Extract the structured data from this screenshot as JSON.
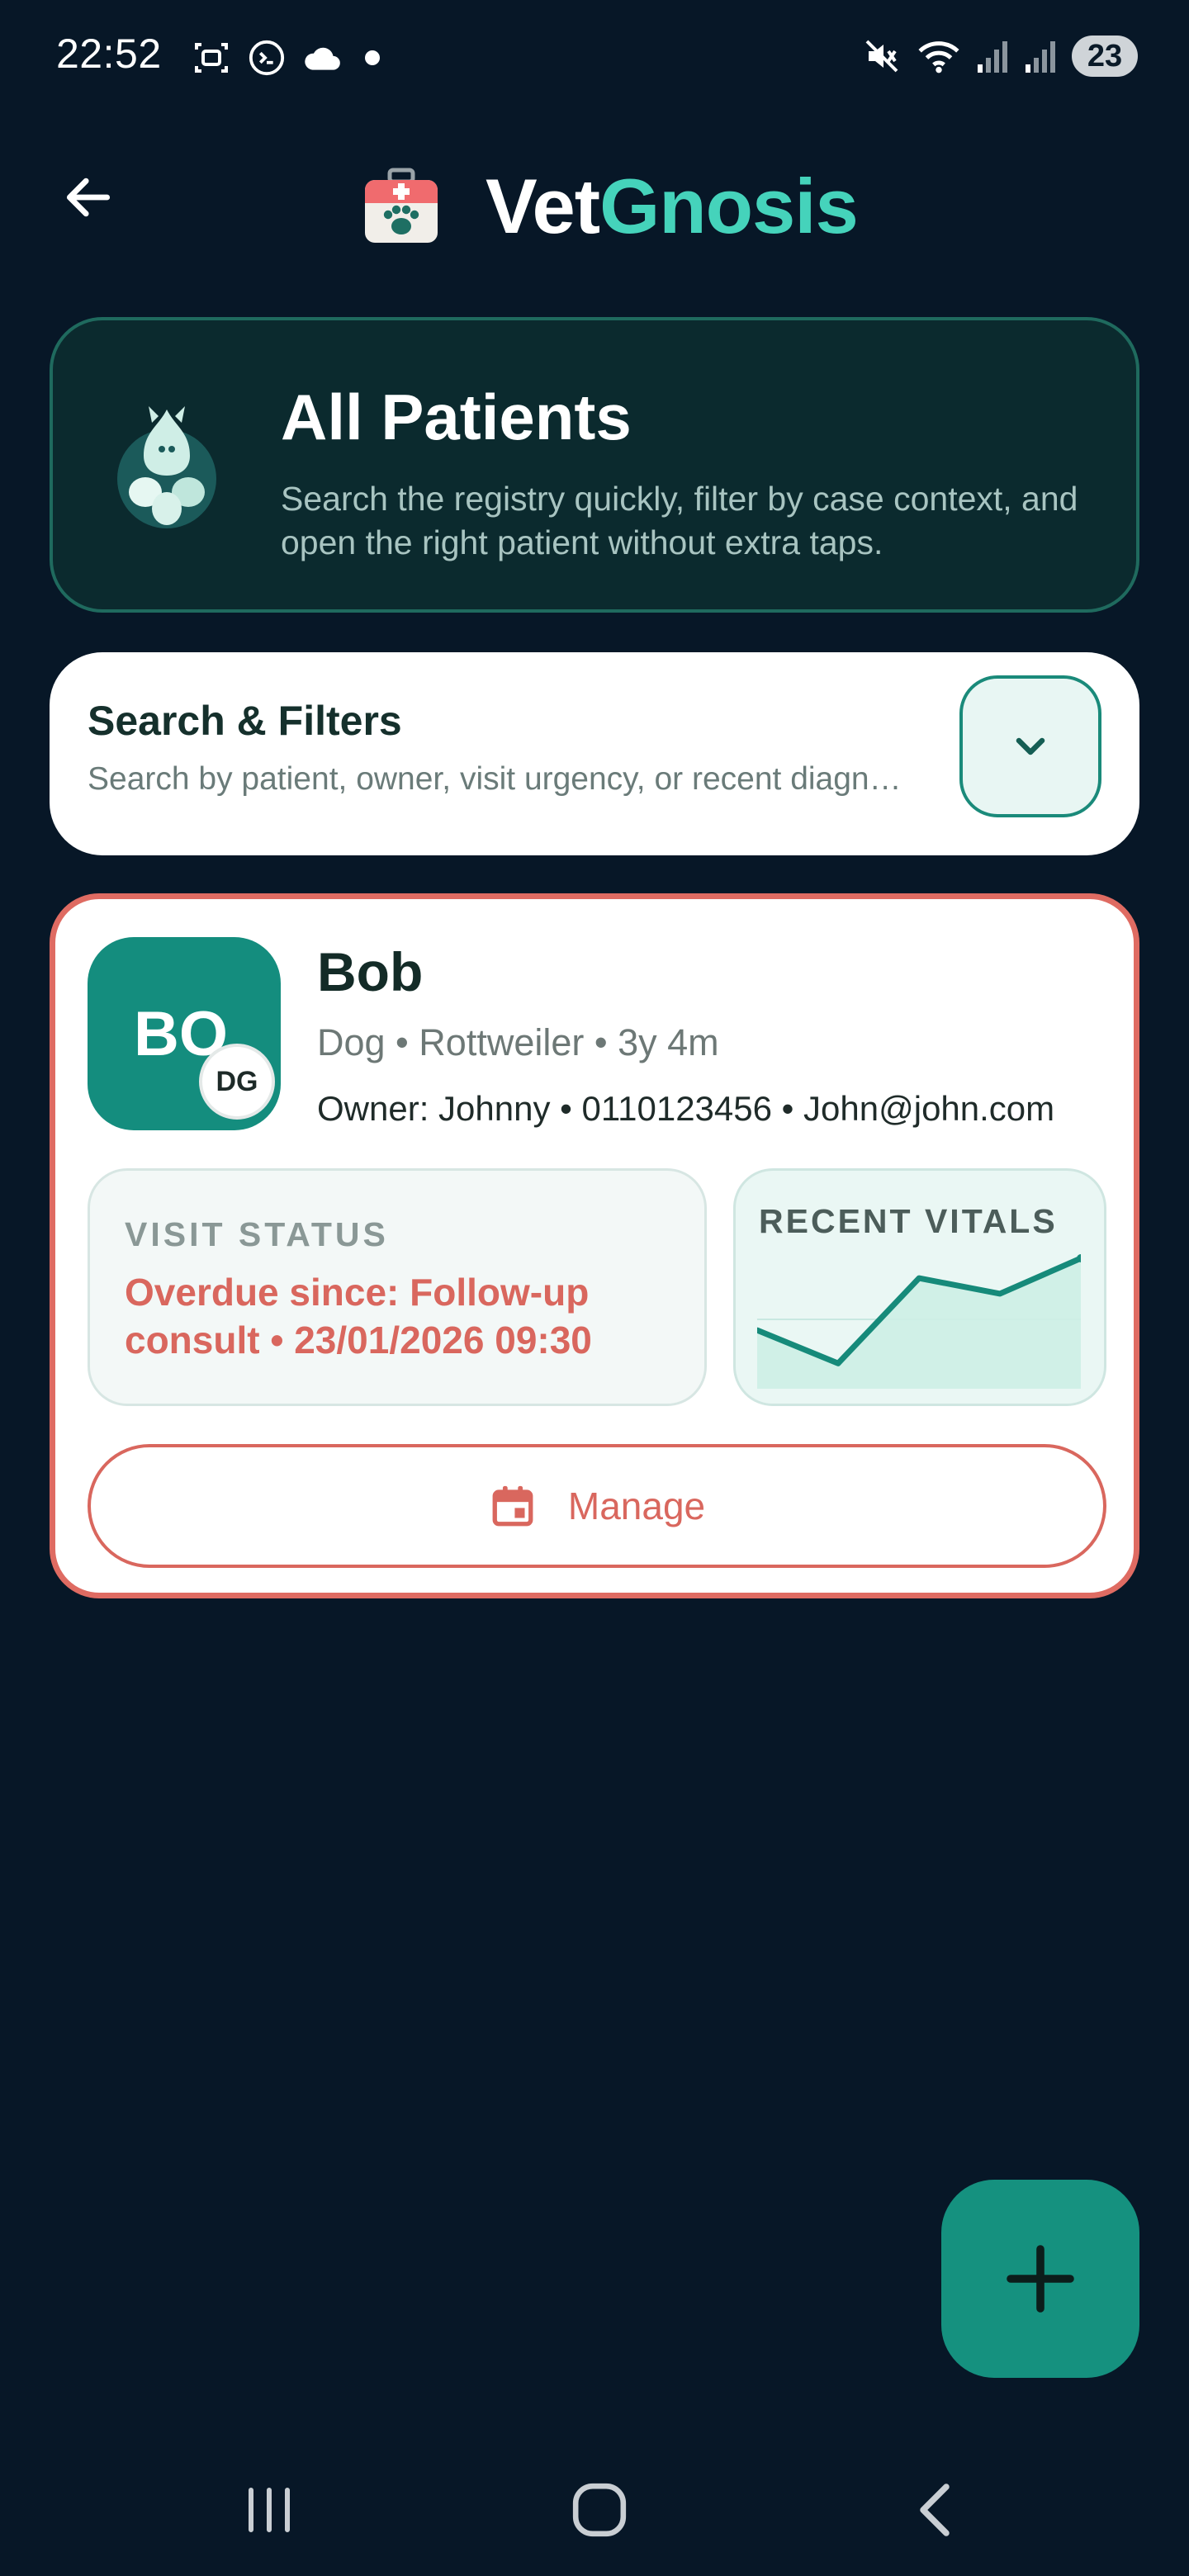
{
  "status_bar": {
    "time": "22:52",
    "left_icons": [
      "screenshot-icon",
      "terminal-icon",
      "cloud-icon",
      "dot-icon"
    ],
    "right_icons": [
      "mute-icon",
      "wifi-icon",
      "signal-icon",
      "signal-icon"
    ],
    "battery": "23"
  },
  "app_bar": {
    "title_part1": "Vet",
    "title_part2": "Gnosis",
    "back_icon": "arrow-left-icon",
    "logo_icon": "vet-kit-icon"
  },
  "hero": {
    "title": "All Patients",
    "subtitle": "Search the registry quickly, filter by case context, and open the right patient without extra taps."
  },
  "filters": {
    "title": "Search & Filters",
    "subtitle": "Search by patient, owner, visit urgency, or recent diagn…",
    "toggle_icon": "chevron-down-icon"
  },
  "patient": {
    "initials": "BO",
    "species_badge": "DG",
    "name": "Bob",
    "meta": "Dog • Rottweiler • 3y 4m",
    "owner": "Owner: Johnny • 0110123456 • John@john.com",
    "visit_status_label": "VISIT STATUS",
    "visit_status_value": "Overdue since: Follow-up consult • 23/01/2026 09:30",
    "vitals_label": "RECENT VITALS",
    "manage_label": "Manage"
  },
  "chart_data": {
    "type": "area",
    "title": "RECENT VITALS",
    "x": [
      1,
      2,
      3,
      4,
      5
    ],
    "values": [
      0.35,
      0.05,
      0.82,
      0.68,
      1.0
    ]
  },
  "colors": {
    "background": "#071727",
    "accent": "#45d3bb",
    "primary": "#148d7e",
    "alert": "#d9675e"
  },
  "nav": {
    "recents_icon": "recents-icon",
    "home_icon": "home-icon",
    "back_icon": "nav-back-icon"
  }
}
